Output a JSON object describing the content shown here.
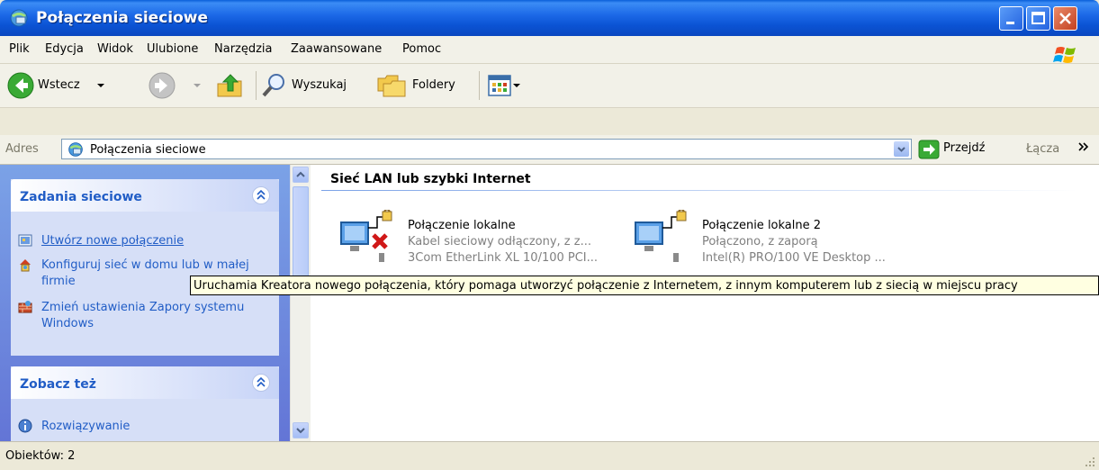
{
  "window": {
    "title": "Połączenia sieciowe"
  },
  "menu": [
    {
      "label": "Plik"
    },
    {
      "label": "Edycja"
    },
    {
      "label": "Widok"
    },
    {
      "label": "Ulubione"
    },
    {
      "label": "Narzędzia"
    },
    {
      "label": "Zaawansowane"
    },
    {
      "label": "Pomoc"
    }
  ],
  "toolbar": {
    "back_label": "Wstecz",
    "search_label": "Wyszukaj",
    "folders_label": "Foldery"
  },
  "address": {
    "label": "Adres",
    "value": "Połączenia sieciowe",
    "go_label": "Przejdź",
    "links_label": "Łącza"
  },
  "leftpane": {
    "network_tasks": {
      "title": "Zadania sieciowe",
      "items": [
        {
          "label": "Utwórz nowe połączenie"
        },
        {
          "label": "Konfiguruj sieć w domu lub w małej firmie"
        },
        {
          "label": "Zmień ustawienia Zapory systemu Windows"
        }
      ]
    },
    "see_also": {
      "title": "Zobacz też",
      "items": [
        {
          "label": "Rozwiązywanie"
        }
      ]
    }
  },
  "content": {
    "group_title": "Sieć LAN lub szybki Internet",
    "connections": [
      {
        "name": "Połączenie lokalne",
        "status": "Kabel sieciowy odłączony, z z...",
        "device": "3Com EtherLink XL 10/100 PCI..."
      },
      {
        "name": "Połączenie lokalne 2",
        "status": "Połączono, z zaporą",
        "device": "Intel(R) PRO/100 VE Desktop ..."
      }
    ]
  },
  "tooltip": {
    "text": "Uruchamia Kreatora nowego połączenia, który pomaga utworzyć połączenie z Internetem, z innym komputerem lub z siecią w miejscu pracy"
  },
  "statusbar": {
    "text": "Obiektów: 2"
  },
  "colors": {
    "accent": "#215dc6",
    "title_bar": "#0b53d4",
    "tooltip_bg": "#ffffe1"
  }
}
